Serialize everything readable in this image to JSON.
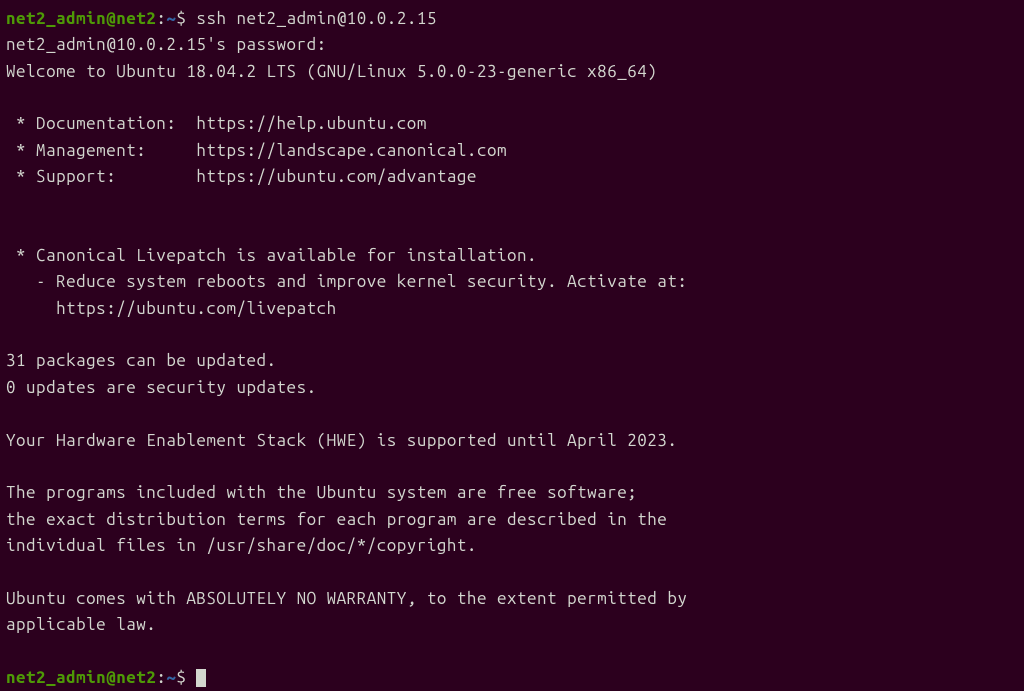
{
  "prompt": {
    "userhost": "net2_admin@net2",
    "sep": ":",
    "path": "~",
    "end": "$ "
  },
  "cmd1": "ssh net2_admin@10.0.2.15",
  "passwordLine": "net2_admin@10.0.2.15's password:",
  "welcome": "Welcome to Ubuntu 18.04.2 LTS (GNU/Linux 5.0.0-23-generic x86_64)",
  "links": {
    "doc": " * Documentation:  https://help.ubuntu.com",
    "mgmt": " * Management:     https://landscape.canonical.com",
    "support": " * Support:        https://ubuntu.com/advantage"
  },
  "livepatch": {
    "l1": " * Canonical Livepatch is available for installation.",
    "l2": "   - Reduce system reboots and improve kernel security. Activate at:",
    "l3": "     https://ubuntu.com/livepatch"
  },
  "updates": {
    "l1": "31 packages can be updated.",
    "l2": "0 updates are security updates."
  },
  "hwe": "Your Hardware Enablement Stack (HWE) is supported until April 2023.",
  "legal": {
    "l1": "The programs included with the Ubuntu system are free software;",
    "l2": "the exact distribution terms for each program are described in the",
    "l3": "individual files in /usr/share/doc/*/copyright."
  },
  "warranty": {
    "l1": "Ubuntu comes with ABSOLUTELY NO WARRANTY, to the extent permitted by",
    "l2": "applicable law."
  }
}
